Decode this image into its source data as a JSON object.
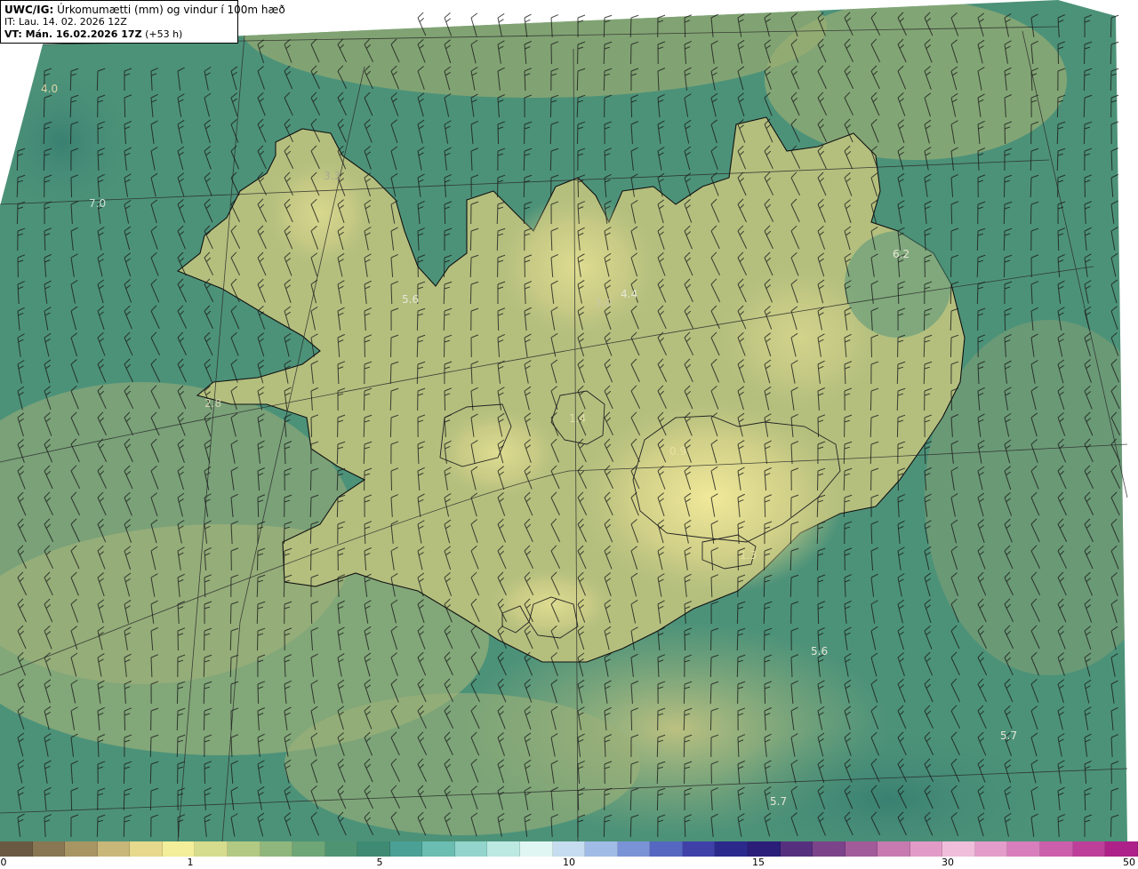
{
  "header": {
    "product": "UWC/IG:",
    "title": "Úrkomumætti (mm) og vindur í 100m hæð",
    "issue_time": "IT: Lau. 14. 02. 2026 12Z",
    "valid_prefix": "VT: Mán. 16.02.2026 17Z",
    "valid_suffix": "(+53 h)"
  },
  "map_labels": [
    {
      "text": "4.0"
    },
    {
      "text": "7.0"
    },
    {
      "text": "3.3"
    },
    {
      "text": "5.6"
    },
    {
      "text": "4.4"
    },
    {
      "text": "3.0"
    },
    {
      "text": "6.2"
    },
    {
      "text": "2.8"
    },
    {
      "text": "1.4"
    },
    {
      "text": "0.9"
    },
    {
      "text": "1.3"
    },
    {
      "text": "5.6"
    },
    {
      "text": "5.7"
    },
    {
      "text": "5.7"
    }
  ],
  "colorbar": {
    "tick_labels": [
      "0",
      "1",
      "5",
      "10",
      "15",
      "30",
      "50"
    ],
    "colors": [
      "#6b5a43",
      "#897653",
      "#a89564",
      "#c8b778",
      "#e6d98d",
      "#f3ee9a",
      "#d6dc8d",
      "#b2c983",
      "#8fb67c",
      "#6ea677",
      "#4f9472",
      "#3e8a73",
      "#4aa094",
      "#6bbcb1",
      "#93d5cc",
      "#bde9e3",
      "#dff6f3",
      "#c6ddf0",
      "#9fbbe6",
      "#7a93d6",
      "#5567c0",
      "#3f40a8",
      "#2b2a8c",
      "#2a1e78",
      "#56307f",
      "#7b438a",
      "#a25b99",
      "#c77ab0",
      "#e29bc7",
      "#f0bedb",
      "#e49ccb",
      "#d97ebc",
      "#cc5fab",
      "#bd3f9a",
      "#ad2189"
    ]
  },
  "colors": {
    "ocean": "#4c9279",
    "land": "#b9c27f",
    "highland": "#e8df8e",
    "coastline": "#111111"
  }
}
